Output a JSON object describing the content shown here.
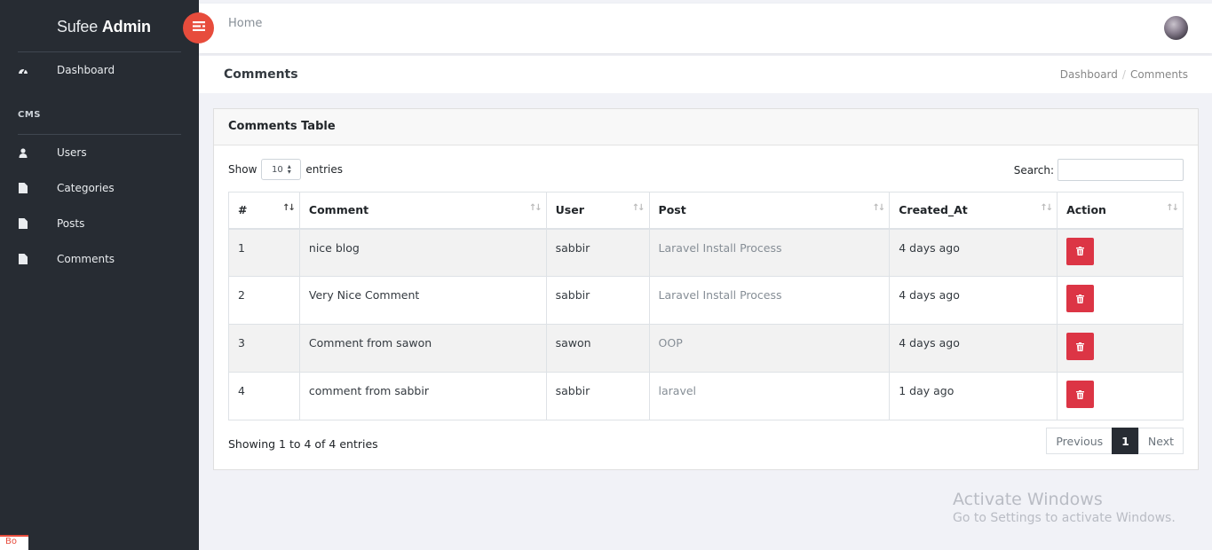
{
  "brand": {
    "light": "Sufee",
    "bold": "Admin"
  },
  "sidebar": {
    "items": [
      {
        "label": "Dashboard",
        "icon": "dashboard-icon"
      },
      {
        "label": "Users",
        "icon": "user-icon"
      },
      {
        "label": "Categories",
        "icon": "file-icon"
      },
      {
        "label": "Posts",
        "icon": "file-icon"
      },
      {
        "label": "Comments",
        "icon": "file-icon"
      }
    ],
    "section_title": "CMS",
    "badge": "Bo"
  },
  "header": {
    "home": "Home"
  },
  "breadcrumb": {
    "title": "Comments",
    "items": [
      "Dashboard",
      "Comments"
    ]
  },
  "card": {
    "title": "Comments Table",
    "show_label": "Show",
    "entries_label": "entries",
    "length_value": "10",
    "search_label": "Search:",
    "search_value": ""
  },
  "table": {
    "headers": [
      "#",
      "Comment",
      "User",
      "Post",
      "Created_At",
      "Action"
    ],
    "rows": [
      {
        "id": "1",
        "comment": "nice blog",
        "user": "sabbir",
        "post": "Laravel Install Process",
        "created": "4 days ago"
      },
      {
        "id": "2",
        "comment": "Very Nice Comment",
        "user": "sabbir",
        "post": "Laravel Install Process",
        "created": "4 days ago"
      },
      {
        "id": "3",
        "comment": "Comment from sawon",
        "user": "sawon",
        "post": "OOP",
        "created": "4 days ago"
      },
      {
        "id": "4",
        "comment": "comment from sabbir",
        "user": "sabbir",
        "post": "laravel",
        "created": "1 day ago"
      }
    ]
  },
  "footer": {
    "info": "Showing 1 to 4 of 4 entries",
    "prev": "Previous",
    "page": "1",
    "next": "Next"
  },
  "watermark": {
    "line1": "Activate Windows",
    "line2": "Go to Settings to activate Windows."
  },
  "colors": {
    "sidebar": "#272c33",
    "accent": "#e74c3c",
    "danger": "#dc3545"
  }
}
